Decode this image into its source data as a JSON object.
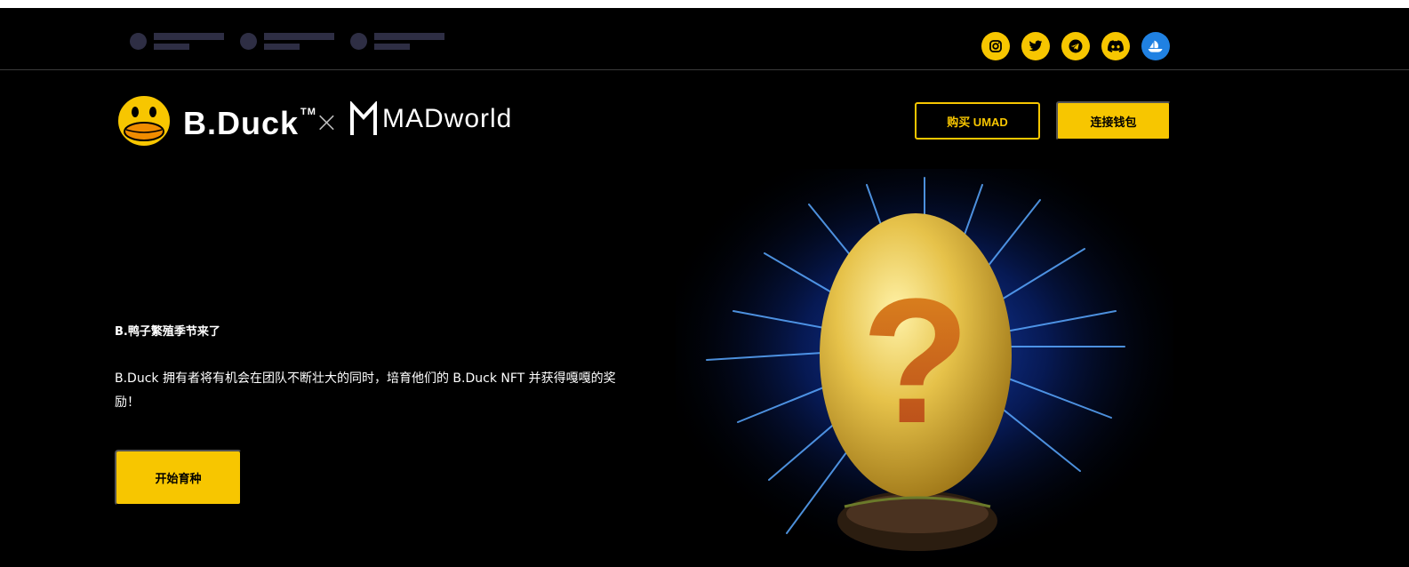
{
  "topbar": {
    "social_links": [
      {
        "icon": "instagram-icon"
      },
      {
        "icon": "twitter-icon"
      },
      {
        "icon": "telegram-icon"
      },
      {
        "icon": "discord-icon"
      },
      {
        "icon": "opensea-icon"
      }
    ]
  },
  "header": {
    "brand": "B.Duck",
    "trademark": "TM",
    "separator": "×",
    "partner": "MADworld",
    "buy_button": "购买 UMAD",
    "wallet_button": "连接钱包"
  },
  "hero": {
    "title": "B.鸭子繁殖季节来了",
    "description": "B.Duck 拥有者将有机会在团队不断壮大的同时，培育他们的 B.Duck NFT 并获得嘎嘎的奖励！",
    "start_button": "开始育种",
    "artwork_glyph": "?"
  },
  "colors": {
    "accent": "#f7c600",
    "background": "#000000",
    "opensea": "#2081e2"
  }
}
